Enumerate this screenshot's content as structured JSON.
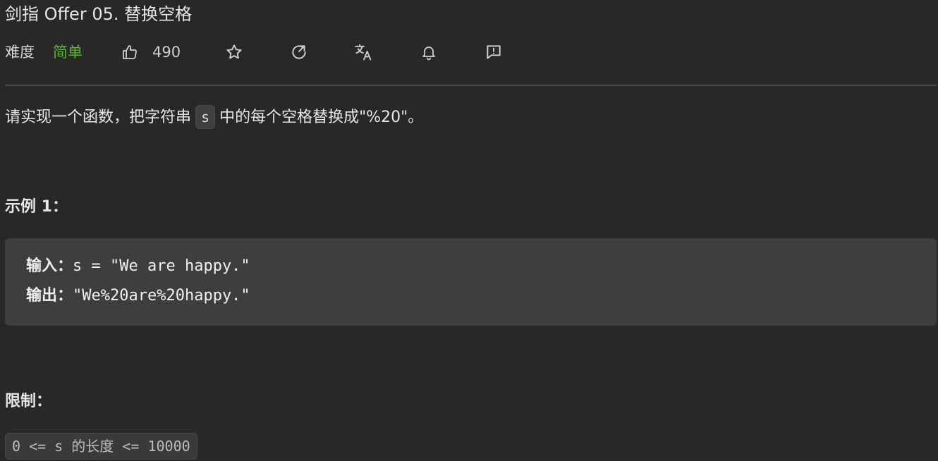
{
  "problem": {
    "title": "剑指 Offer 05. 替换空格",
    "difficulty_label": "难度",
    "difficulty_value": "简单",
    "likes": "490"
  },
  "description": {
    "before_code": "请实现一个函数，把字符串",
    "code": "s",
    "after_code": "中的每个空格替换成\"%20\"。"
  },
  "example": {
    "heading": "示例 1：",
    "input_label": "输入：",
    "input_value": "s = \"We are happy.\"",
    "output_label": "输出：",
    "output_value": "\"We%20are%20happy.\""
  },
  "limits": {
    "heading": "限制：",
    "constraint": "0 <= s 的长度 <= 10000"
  },
  "icons": {
    "like": "thumbs-up-icon",
    "star": "star-icon",
    "share": "share-icon",
    "translate": "translate-icon",
    "bell": "bell-icon",
    "feedback": "feedback-icon"
  },
  "colors": {
    "background": "#282828",
    "easy": "#5ab726",
    "code_bg": "#3e3e3e"
  }
}
